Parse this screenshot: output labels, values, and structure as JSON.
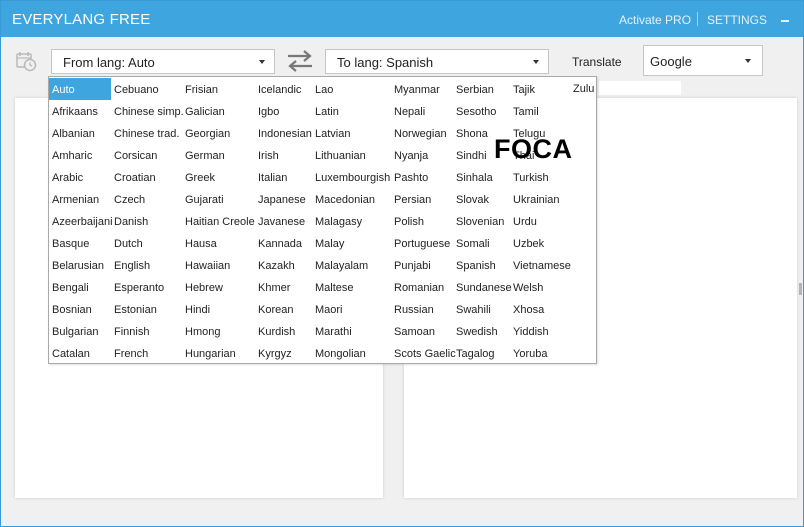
{
  "app": {
    "title": "EVERYLANG FREE",
    "activate_pro": "Activate PRO",
    "settings": "SETTINGS"
  },
  "toolbar": {
    "from_lang": "From lang: Auto",
    "to_lang": "To lang: Spanish",
    "translate": "Translate",
    "engine": "Google"
  },
  "colors": {
    "accent": "#3ea5de"
  },
  "icons": {
    "history": "clock-calendar-icon",
    "swap": "swap-arrows-icon",
    "minimize": "minimize-icon"
  },
  "languages": {
    "selected": "Auto",
    "columns": [
      [
        "Auto",
        "Afrikaans",
        "Albanian",
        "Amharic",
        "Arabic",
        "Armenian",
        "Azeerbaijani",
        "Basque",
        "Belarusian",
        "Bengali",
        "Bosnian",
        "Bulgarian",
        "Catalan"
      ],
      [
        "Cebuano",
        "Chinese simp.",
        "Chinese trad.",
        "Corsican",
        "Croatian",
        "Czech",
        "Danish",
        "Dutch",
        "English",
        "Esperanto",
        "Estonian",
        "Finnish",
        "French"
      ],
      [
        "Frisian",
        "Galician",
        "Georgian",
        "German",
        "Greek",
        "Gujarati",
        "Haitian Creole",
        "Hausa",
        "Hawaiian",
        "Hebrew",
        "Hindi",
        "Hmong",
        "Hungarian"
      ],
      [
        "Icelandic",
        "Igbo",
        "Indonesian",
        "Irish",
        "Italian",
        "Japanese",
        "Javanese",
        "Kannada",
        "Kazakh",
        "Khmer",
        "Korean",
        "Kurdish",
        "Kyrgyz"
      ],
      [
        "Lao",
        "Latin",
        "Latvian",
        "Lithuanian",
        "Luxembourgish",
        "Macedonian",
        "Malagasy",
        "Malay",
        "Malayalam",
        "Maltese",
        "Maori",
        "Marathi",
        "Mongolian"
      ],
      [
        "Myanmar",
        "Nepali",
        "Norwegian",
        "Nyanja",
        "Pashto",
        "Persian",
        "Polish",
        "Portuguese",
        "Punjabi",
        "Romanian",
        "Russian",
        "Samoan",
        "Scots Gaelic"
      ],
      [
        "Serbian",
        "Sesotho",
        "Shona",
        "Sindhi",
        "Sinhala",
        "Slovak",
        "Slovenian",
        "Somali",
        "Spanish",
        "Sundanese",
        "Swahili",
        "Swedish",
        "Tagalog"
      ],
      [
        "Tajik",
        "Tamil",
        "Telugu",
        "Thai",
        "Turkish",
        "Ukrainian",
        "Urdu",
        "Uzbek",
        "Vietnamese",
        "Welsh",
        "Xhosa",
        "Yiddish",
        "Yoruba"
      ]
    ],
    "overflow": "Zulu"
  },
  "watermark": "FOCA"
}
